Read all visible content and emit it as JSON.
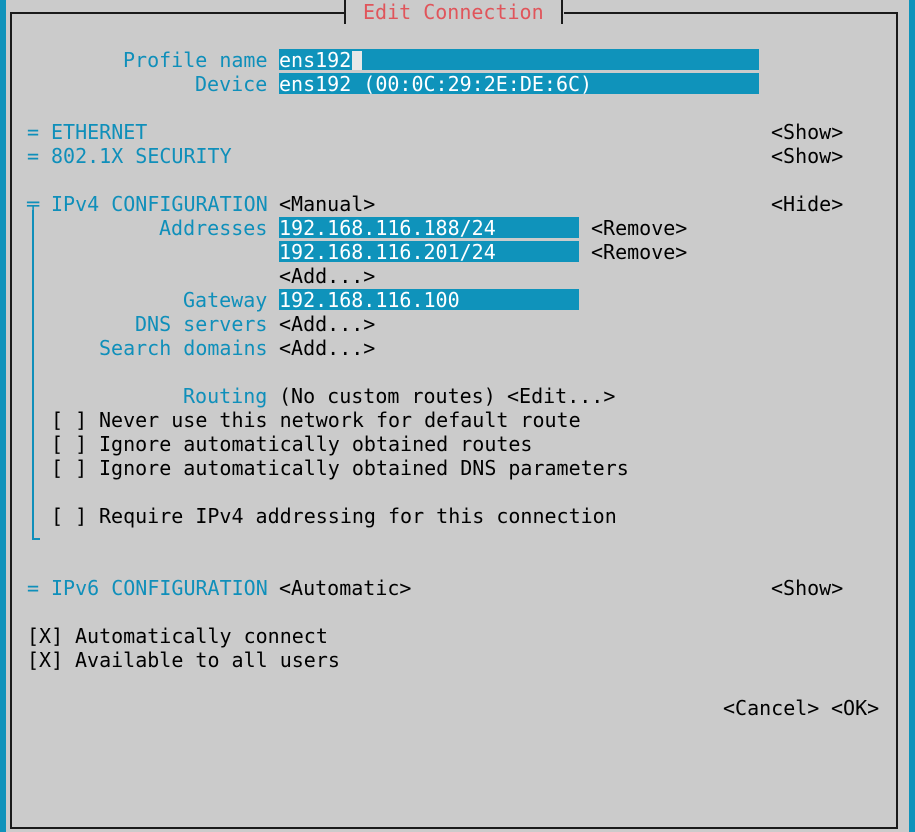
{
  "dialog": {
    "title": "Edit Connection"
  },
  "profile": {
    "profile_name_label": "Profile name",
    "profile_name_value": "ens192",
    "device_label": "Device",
    "device_value": "ens192 (00:0C:29:2E:DE:6C)"
  },
  "sections": {
    "ethernet": {
      "marker": "=",
      "label": "ETHERNET",
      "toggle": "<Show>"
    },
    "security": {
      "marker": "=",
      "label": "802.1X SECURITY",
      "toggle": "<Show>"
    },
    "ipv4": {
      "marker": "╤",
      "label": "IPv4 CONFIGURATION",
      "mode": "<Manual>",
      "toggle": "<Hide>"
    },
    "ipv6": {
      "marker": "=",
      "label": "IPv6 CONFIGURATION",
      "mode": "<Automatic>",
      "toggle": "<Show>"
    }
  },
  "ipv4": {
    "addresses_label": "Addresses",
    "addresses": [
      {
        "value": "192.168.116.188/24",
        "remove": "<Remove>"
      },
      {
        "value": "192.168.116.201/24",
        "remove": "<Remove>"
      }
    ],
    "add_address": "<Add...>",
    "gateway_label": "Gateway",
    "gateway_value": "192.168.116.100",
    "dns_label": "DNS servers",
    "dns_add": "<Add...>",
    "search_label": "Search domains",
    "search_add": "<Add...>",
    "routing_label": "Routing",
    "routing_value": "(No custom routes)",
    "routing_edit": "<Edit...>",
    "options": [
      {
        "box": "[ ]",
        "label": "Never use this network for default route"
      },
      {
        "box": "[ ]",
        "label": "Ignore automatically obtained routes"
      },
      {
        "box": "[ ]",
        "label": "Ignore automatically obtained DNS parameters"
      },
      {
        "box": "[ ]",
        "label": "Require IPv4 addressing for this connection"
      }
    ]
  },
  "general": {
    "autoconnect": {
      "box": "[X]",
      "label": "Automatically connect"
    },
    "all_users": {
      "box": "[X]",
      "label": "Available to all users"
    }
  },
  "footer": {
    "cancel": "<Cancel>",
    "ok": "<OK>"
  },
  "colors": {
    "accent": "#0f93bb",
    "title": "#e0555b",
    "background": "#cbcbcb"
  }
}
